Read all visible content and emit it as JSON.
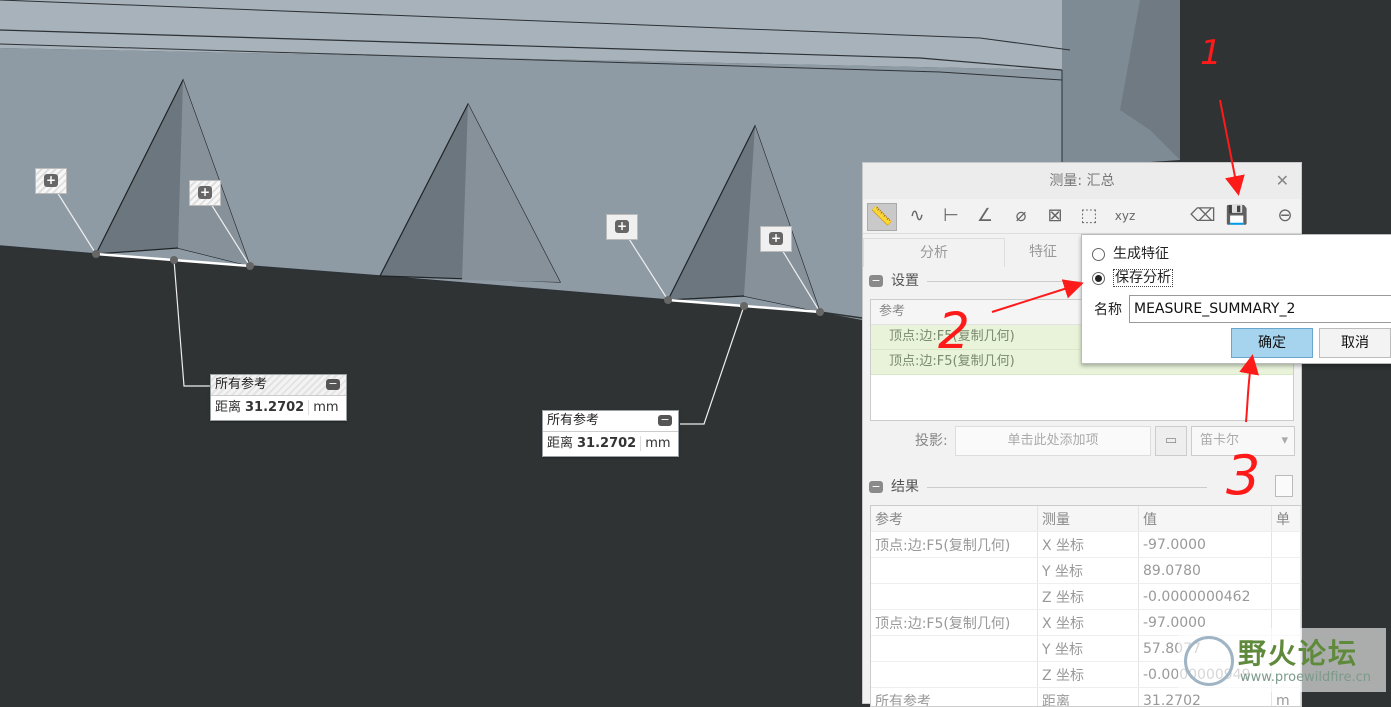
{
  "callouts": [
    {
      "title": "所有参考",
      "label": "距离",
      "value": "31.2702",
      "unit": "mm"
    },
    {
      "title": "所有参考",
      "label": "距离",
      "value": "31.2702",
      "unit": "mm"
    }
  ],
  "dialog": {
    "title": "测量: 汇总",
    "tabs": [
      "分析",
      "特征"
    ],
    "settings_label": "设置",
    "refs_header": "参考",
    "refs": [
      "顶点:边:F5(复制几何)",
      "顶点:边:F5(复制几何)"
    ],
    "projection_label": "投影:",
    "projection_placeholder": "单击此处添加项",
    "coord_system": "笛卡尔",
    "results_label": "结果",
    "results": {
      "columns": [
        "参考",
        "测量",
        "值",
        "单"
      ],
      "rows": [
        [
          "顶点:边:F5(复制几何)",
          "X 坐标",
          "-97.0000",
          ""
        ],
        [
          "",
          "Y 坐标",
          "89.0780",
          ""
        ],
        [
          "",
          "Z 坐标",
          "-0.0000000462",
          ""
        ],
        [
          "顶点:边:F5(复制几何)",
          "X 坐标",
          "-97.0000",
          ""
        ],
        [
          "",
          "Y 坐标",
          "57.8077",
          ""
        ],
        [
          "",
          "Z 坐标",
          "-0.0000000949",
          ""
        ],
        [
          "所有参考",
          "距离",
          "31.2702",
          "m"
        ]
      ]
    }
  },
  "popup": {
    "option1": "生成特征",
    "option2": "保存分析",
    "name_label": "名称",
    "name_value": "MEASURE_SUMMARY_2",
    "ok": "确定",
    "cancel": "取消"
  },
  "watermark": {
    "title": "野火论坛",
    "url": "www.proewildfire.cn"
  },
  "annotations": {
    "n1": "1",
    "n2": "2",
    "n3": "3"
  },
  "colors": {
    "annotation": "#ff1a1a",
    "ok_button": "#a6d3ee"
  }
}
